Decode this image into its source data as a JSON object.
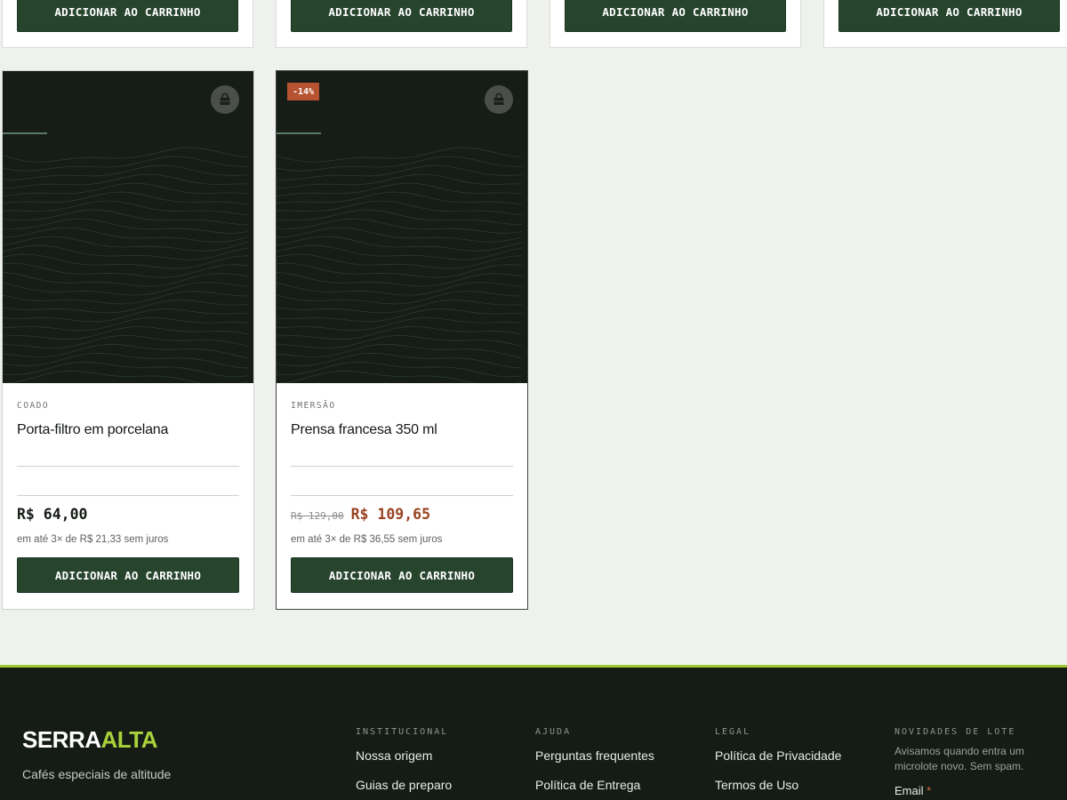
{
  "colors": {
    "primary": "#27452d",
    "accent": "#a9d13c",
    "sale": "#9a4222",
    "badge": "#b75330",
    "footer_bg": "#141c15"
  },
  "top_row": {
    "cart_label": "ADICIONAR AO CARRINHO"
  },
  "products": [
    {
      "category": "COADO",
      "name": "Porta-filtro em porcelana",
      "price": "R$ 64,00",
      "installments": "em até 3× de R$ 21,33 sem juros",
      "cart_label": "ADICIONAR AO CARRINHO",
      "icon": "shopping-bag-icon"
    },
    {
      "badge": "-14%",
      "category": "IMERSÃO",
      "name": "Prensa francesa 350 ml",
      "old_price": "R$ 129,00",
      "price": "R$ 109,65",
      "installments": "em até 3× de R$ 36,55 sem juros",
      "cart_label": "ADICIONAR AO CARRINHO",
      "icon": "shopping-bag-icon"
    }
  ],
  "footer": {
    "brand_part1": "SERRA",
    "brand_part2": "ALTA",
    "tagline": "Cafés especiais de altitude",
    "columns": [
      {
        "title": "INSTITUCIONAL",
        "links": [
          "Nossa origem",
          "Guias de preparo"
        ]
      },
      {
        "title": "AJUDA",
        "links": [
          "Perguntas frequentes",
          "Política de Entrega"
        ]
      },
      {
        "title": "LEGAL",
        "links": [
          "Política de Privacidade",
          "Termos de Uso"
        ]
      }
    ],
    "newsletter": {
      "title": "NOVIDADES DE LOTE",
      "text": "Avisamos quando entra um microlote novo. Sem spam.",
      "email_label": "Email",
      "required_mark": "*"
    }
  }
}
